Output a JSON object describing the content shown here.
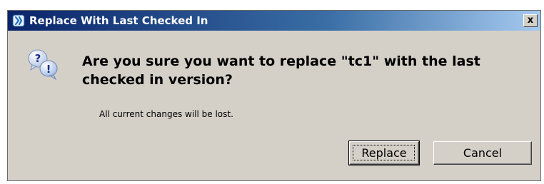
{
  "window": {
    "title": "Replace With Last Checked In",
    "app_icon": "version-control-icon",
    "close_label": "x"
  },
  "content": {
    "icon": "question-exclamation-icon",
    "message": "Are you sure you want to replace \"tc1\" with the last checked in version?",
    "detail": "All current changes will be lost."
  },
  "buttons": {
    "replace_label": "Replace",
    "cancel_label": "Cancel"
  },
  "colors": {
    "titlebar_start": "#0a246a",
    "titlebar_end": "#a6caf0",
    "dialog_bg": "#d4d0c8"
  }
}
